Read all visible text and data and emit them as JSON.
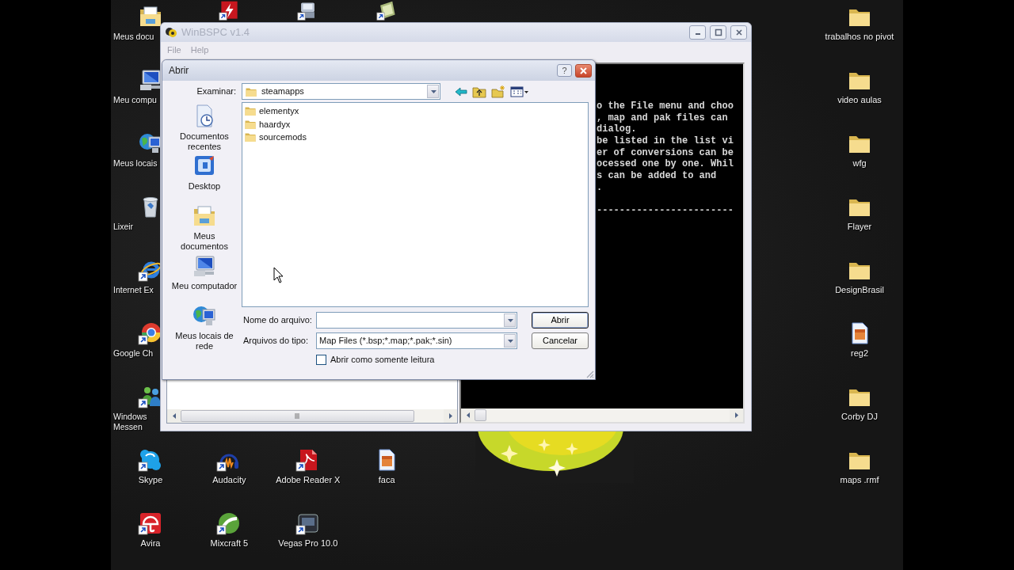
{
  "desktop": {
    "left_column": [
      {
        "label": "Meus docu",
        "kind": "documents",
        "shortcut": false
      },
      {
        "label": "Meu compu",
        "kind": "computer",
        "shortcut": false
      },
      {
        "label": "Meus locais",
        "kind": "network",
        "shortcut": false
      },
      {
        "label": "Lixeir",
        "kind": "trash",
        "shortcut": false
      },
      {
        "label": "Internet Ex",
        "kind": "ie",
        "shortcut": true
      },
      {
        "label": "Google Ch",
        "kind": "chrome",
        "shortcut": true
      },
      {
        "label": "Windows Messen",
        "kind": "messenger",
        "shortcut": true
      },
      {
        "label": "Skype",
        "kind": "skype",
        "shortcut": true
      },
      {
        "label": "Avira",
        "kind": "avira",
        "shortcut": true
      }
    ],
    "top_row": [
      {
        "kind": "filezilla",
        "shortcut": true
      },
      {
        "kind": "device",
        "shortcut": true
      },
      {
        "kind": "notes",
        "shortcut": true
      }
    ],
    "bottom_rows": [
      [
        {
          "label": "Audacity",
          "kind": "audacity",
          "shortcut": true
        },
        {
          "label": "Adobe Reader X",
          "kind": "pdf",
          "shortcut": true
        },
        {
          "label": "faca",
          "kind": "file",
          "shortcut": false
        }
      ],
      [
        {
          "label": "Mixcraft 5",
          "kind": "mixcraft",
          "shortcut": true
        },
        {
          "label": "Vegas Pro 10.0",
          "kind": "vegas",
          "shortcut": true
        }
      ]
    ],
    "right_column": [
      {
        "label": "trabalhos no pivot",
        "kind": "folder",
        "shortcut": false
      },
      {
        "label": "video aulas",
        "kind": "folder",
        "shortcut": false
      },
      {
        "label": "wfg",
        "kind": "folder",
        "shortcut": false
      },
      {
        "label": "Flayer",
        "kind": "folder",
        "shortcut": false
      },
      {
        "label": "DesignBrasil",
        "kind": "folder",
        "shortcut": false
      },
      {
        "label": "reg2",
        "kind": "file",
        "shortcut": false
      },
      {
        "label": "Corby DJ",
        "kind": "folder",
        "shortcut": false
      },
      {
        "label": "maps .rmf",
        "kind": "folder",
        "shortcut": false
      }
    ]
  },
  "main_window": {
    "title": "WinBSPC v1.4",
    "active": false,
    "menu": [
      {
        "label": "File",
        "disabled": true
      },
      {
        "label": "Help",
        "disabled": true
      }
    ],
    "console": {
      "lines": [
        "o the File menu and choo",
        ", map and pak files can",
        "dialog.",
        "be listed in the list vi",
        "er of conversions can be",
        "ocessed one by one. Whil",
        "s can be added to and",
        "."
      ],
      "separator": "------------------------"
    }
  },
  "dialog": {
    "title": "Abrir",
    "help_button": "?",
    "look_in": {
      "label": "Examinar:",
      "value": "steamapps"
    },
    "places": [
      {
        "label": "Documentos recentes",
        "kind": "recent"
      },
      {
        "label": "Desktop",
        "kind": "desktop"
      },
      {
        "label": "Meus documentos",
        "kind": "documents"
      },
      {
        "label": "Meu computador",
        "kind": "computer"
      },
      {
        "label": "Meus locais de rede",
        "kind": "network"
      }
    ],
    "files": [
      {
        "name": "elementyx",
        "selected": false
      },
      {
        "name": "haardyx",
        "selected": false
      },
      {
        "name": "sourcemods",
        "selected": false
      }
    ],
    "file_name": {
      "label": "Nome do arquivo:"
    },
    "file_type": {
      "label": "Arquivos do tipo:",
      "value": "Map Files (*.bsp;*.map;*.pak;*.sin)"
    },
    "read_only": {
      "label": "Abrir como somente leitura",
      "checked": false
    },
    "buttons": [
      {
        "label": "Abrir",
        "default": true
      },
      {
        "label": "Cancelar",
        "default": false
      }
    ]
  }
}
